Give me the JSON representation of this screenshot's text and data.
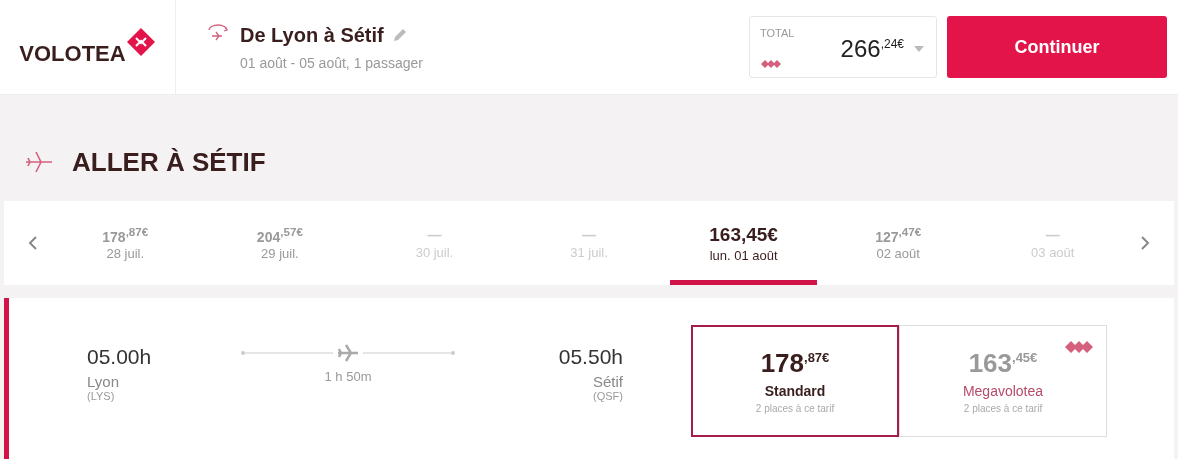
{
  "header": {
    "logo": "VOLOTEA",
    "route": "De Lyon à Sétif",
    "details": "01 août - 05 août, 1 passager",
    "total_label": "TOTAL",
    "total": "266$^{,24€}$",
    "continue": "Continuer"
  },
  "section_title": "ALLER À SÉTIF",
  "dates": [
    {
      "price": "178$^{,87€}$",
      "date": "28 juil.",
      "available": true,
      "selected": false
    },
    {
      "price": "204$^{,57€}$",
      "date": "29 juil.",
      "available": true,
      "selected": false
    },
    {
      "price": "—",
      "date": "30 juil.",
      "available": false,
      "selected": false
    },
    {
      "price": "—",
      "date": "31 juil.",
      "available": false,
      "selected": false
    },
    {
      "price": "163,45€",
      "date": "lun. 01 août",
      "available": true,
      "selected": true
    },
    {
      "price": "127$^{,47€}$",
      "date": "02 août",
      "available": true,
      "selected": false
    },
    {
      "price": "—",
      "date": "03 août",
      "available": false,
      "selected": false
    }
  ],
  "flight": {
    "depart_time": "05.00h",
    "depart_city": "Lyon",
    "depart_code": "(LYS)",
    "duration": "1 h 50m",
    "arrive_time": "05.50h",
    "arrive_city": "Sétif",
    "arrive_code": "(QSF)",
    "fares": [
      {
        "kind": "standard",
        "price": "178$^{,87€}$",
        "name": "Standard",
        "seats": "2 places à ce tarif",
        "selected": true
      },
      {
        "kind": "mega",
        "price": "163$^{,45€}$",
        "name": "Megavolotea",
        "seats": "2 places à ce tarif",
        "selected": false
      }
    ]
  }
}
